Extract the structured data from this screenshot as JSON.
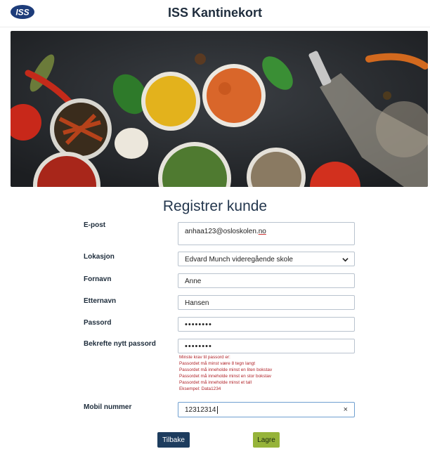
{
  "header": {
    "title": "ISS Kantinekort",
    "logo_text": "ISS"
  },
  "form": {
    "title": "Registrer kunde",
    "email": {
      "label": "E-post",
      "value_user": "anhaa123@osloskolen.",
      "value_tld": "no"
    },
    "location": {
      "label": "Lokasjon",
      "value": "Edvard Munch videregående skole"
    },
    "first_name": {
      "label": "Fornavn",
      "value": "Anne"
    },
    "last_name": {
      "label": "Etternavn",
      "value": "Hansen"
    },
    "password": {
      "label": "Passord",
      "value": "••••••••"
    },
    "password_confirm": {
      "label": "Bekrefte nytt passord",
      "value": "••••••••"
    },
    "password_rules": [
      "Minste krav til passord er:",
      "Passordet må minst være 8 tegn langt",
      "Passordet må inneholde minst en liten bokstav",
      "Passordet må inneholde minst en stor bokstav",
      "Passordet må inneholde minst et tall",
      "Eksempel: Data1234"
    ],
    "phone": {
      "label": "Mobil nummer",
      "value": "12312314",
      "clear_glyph": "×"
    },
    "buttons": {
      "back": "Tilbake",
      "save": "Lagre"
    }
  },
  "colors": {
    "brand_navy": "#1d3c5e",
    "save_green": "#96b43a",
    "error_red": "#b0242a"
  }
}
